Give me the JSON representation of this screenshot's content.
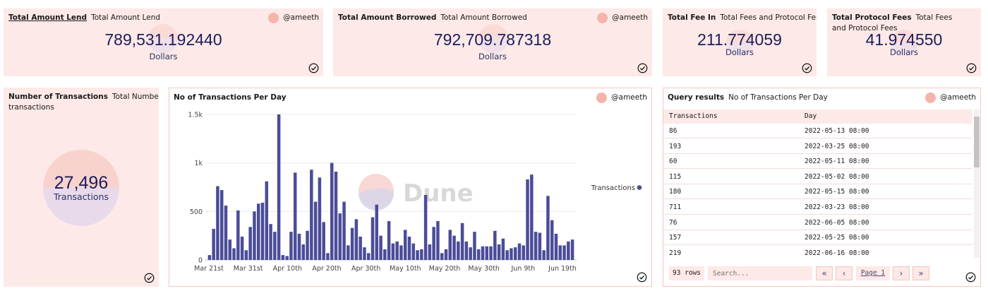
{
  "author": "@ameeth",
  "cards": {
    "lend": {
      "title": "Total Amount Lend",
      "subtitle": "Total Amount Lend",
      "value": "789,531.192440",
      "unit": "Dollars"
    },
    "borrowed": {
      "title": "Total Amount Borrowed",
      "subtitle": "Total Amount Borrowed",
      "value": "792,709.787318",
      "unit": "Dollars"
    },
    "fee": {
      "title": "Total Fee In",
      "subtitle": "Total Fees and Protocol Fees",
      "value": "211.774059",
      "unit": "Dollars"
    },
    "protocol": {
      "title": "Total Protocol Fees",
      "subtitle": "Total Fees and Protocol Fees",
      "value": "41.974550",
      "unit": "Dollars"
    },
    "transactions": {
      "title": "Number of Transactions",
      "subtitle_line1": "Total Number of",
      "subtitle_line2": "transactions",
      "value": "27,496",
      "unit": "Transactions"
    }
  },
  "chart_panel": {
    "title": "No of Transactions Per Day",
    "watermark": "Dune"
  },
  "chart_data": {
    "type": "bar",
    "title": "No of Transactions Per Day",
    "ylim": [
      0,
      1500
    ],
    "yticks": [
      0,
      500,
      1000,
      1500
    ],
    "ytick_labels": [
      "0",
      "500",
      "1k",
      "1.5k"
    ],
    "xtick_labels": [
      "Mar 21st",
      "Mar 31st",
      "Apr 10th",
      "Apr 20th",
      "Apr 30th",
      "May 10th",
      "May 20th",
      "May 30th",
      "Jun 9th",
      "Jun 19th"
    ],
    "grid": true,
    "legend_position": "right",
    "series": [
      {
        "name": "Transactions",
        "color": "#4b4c98",
        "values": [
          50,
          320,
          760,
          720,
          560,
          210,
          120,
          510,
          240,
          100,
          340,
          500,
          580,
          590,
          810,
          370,
          290,
          1500,
          50,
          40,
          290,
          900,
          270,
          160,
          300,
          930,
          600,
          850,
          390,
          70,
          1000,
          910,
          480,
          600,
          150,
          330,
          420,
          240,
          130,
          70,
          440,
          570,
          250,
          110,
          400,
          170,
          190,
          150,
          310,
          240,
          170,
          100,
          110,
          670,
          160,
          340,
          400,
          70,
          110,
          310,
          250,
          190,
          380,
          190,
          130,
          290,
          110,
          140,
          140,
          140,
          300,
          160,
          220,
          100,
          120,
          130,
          170,
          150,
          830,
          880,
          290,
          280,
          100,
          660,
          410,
          270,
          150,
          150,
          190,
          210
        ]
      }
    ]
  },
  "results": {
    "title": "Query results",
    "subtitle": "No of Transactions Per Day",
    "columns": [
      "Transactions",
      "Day"
    ],
    "rows": [
      [
        "86",
        "2022-05-13 08:00"
      ],
      [
        "193",
        "2022-03-25 08:00"
      ],
      [
        "60",
        "2022-05-11 08:00"
      ],
      [
        "115",
        "2022-05-02 08:00"
      ],
      [
        "180",
        "2022-05-15 08:00"
      ],
      [
        "711",
        "2022-03-23 08:00"
      ],
      [
        "76",
        "2022-06-05 08:00"
      ],
      [
        "157",
        "2022-05-25 08:00"
      ],
      [
        "219",
        "2022-06-16 08:00"
      ]
    ],
    "row_count": "93 rows",
    "search_placeholder": "Search...",
    "page_label": "Page 1"
  },
  "icons": {
    "check": "check-circle-icon",
    "first": "double-chevron-left-icon",
    "prev": "chevron-left-icon",
    "next": "chevron-right-icon",
    "last": "double-chevron-right-icon"
  },
  "colors": {
    "panel_bg": "#fde9e7",
    "value_text": "#1b1c5e",
    "bar": "#4b4c98",
    "avatar": "#f5b4aa"
  }
}
